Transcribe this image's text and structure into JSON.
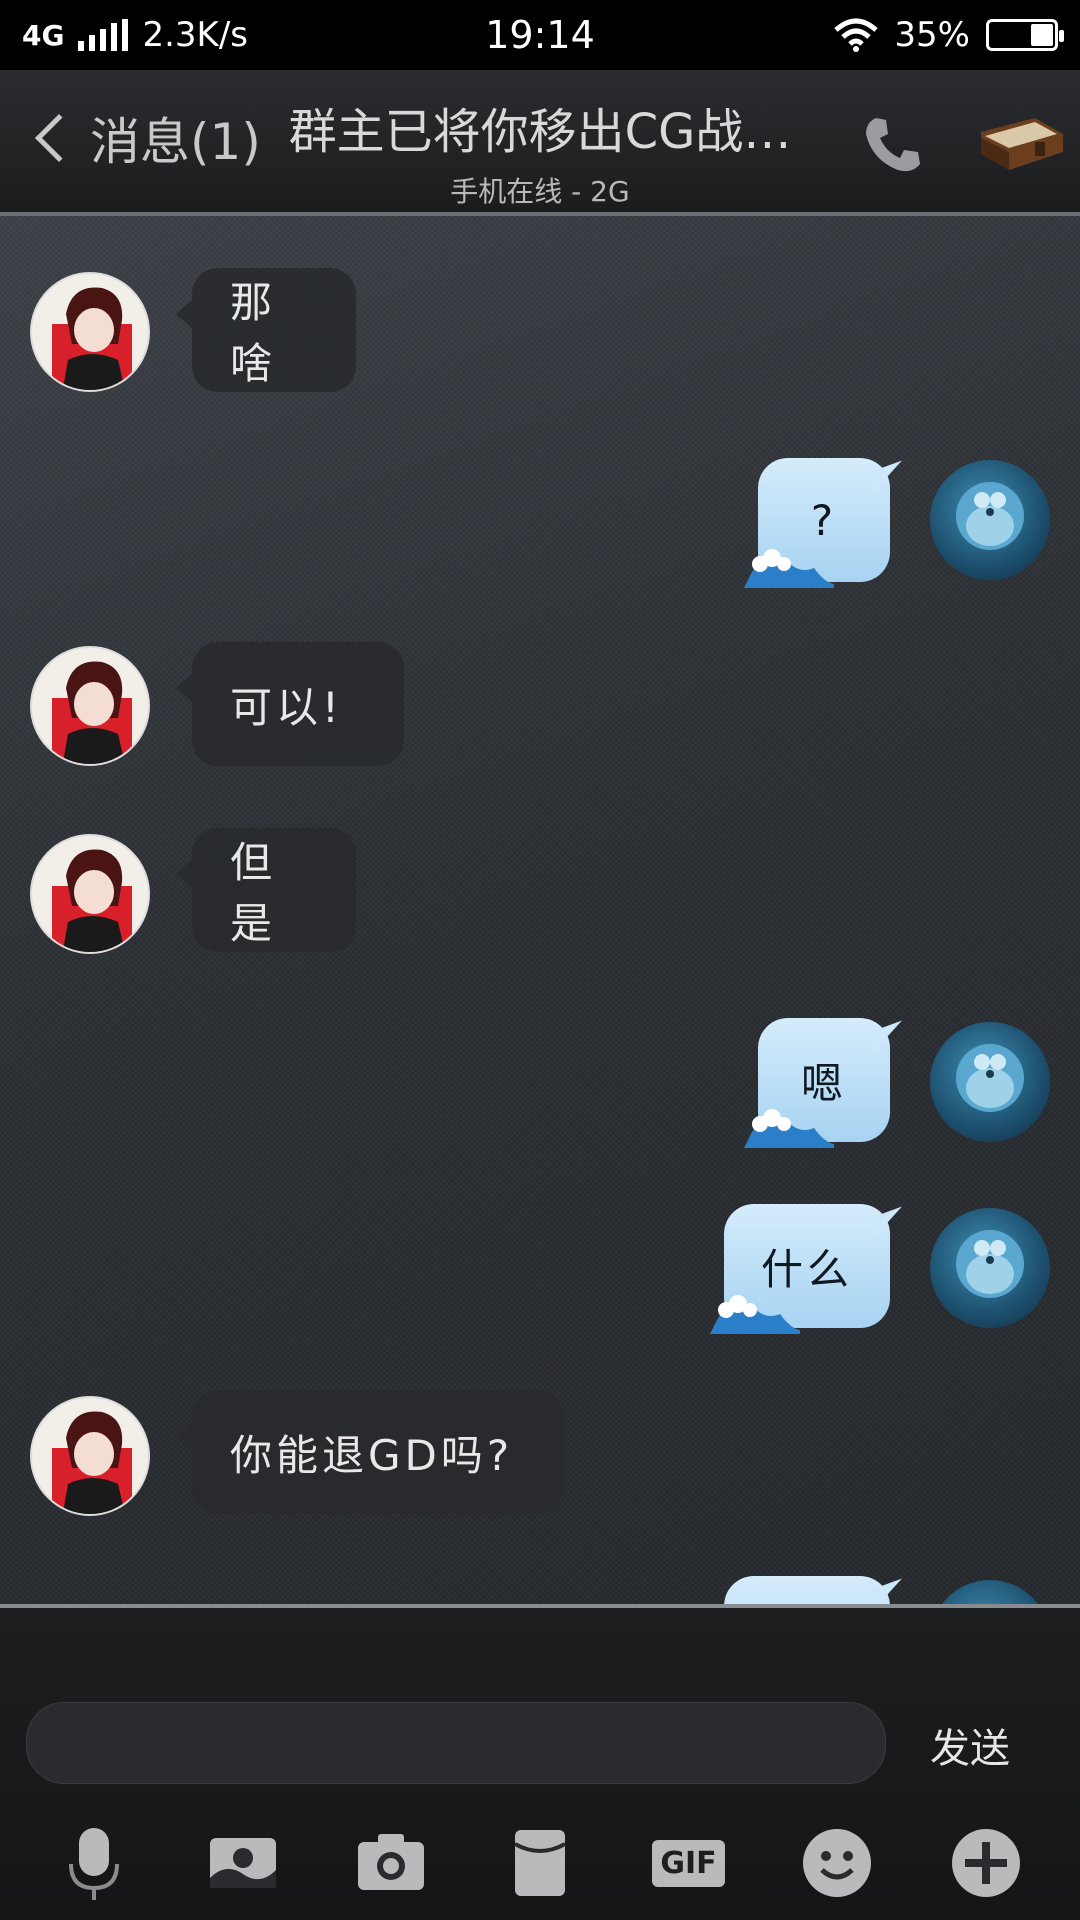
{
  "status_bar": {
    "network": "4G",
    "speed": "2.3K/s",
    "time": "19:14",
    "battery": "35%",
    "battery_level": 0.35,
    "icons": [
      "signal-icon",
      "wifi-icon",
      "battery-icon"
    ]
  },
  "header": {
    "back_label": "消息(1)",
    "title": "群主已将你移出CG战…",
    "subtitle": "手机在线 - 2G",
    "icons": [
      "back-chevron-icon",
      "phone-icon",
      "book-icon"
    ]
  },
  "messages": [
    {
      "side": "in",
      "text": "那啥"
    },
    {
      "side": "out",
      "text": "?"
    },
    {
      "side": "in",
      "text": "可以!"
    },
    {
      "side": "in",
      "text": "但是"
    },
    {
      "side": "out",
      "text": "嗯"
    },
    {
      "side": "out",
      "text": "什么"
    },
    {
      "side": "in",
      "text": "你能退GD吗?"
    }
  ],
  "composer": {
    "input_value": "",
    "send_label": "发送"
  },
  "toolbar": {
    "gif_label": "GIF",
    "icons": [
      "microphone-icon",
      "image-icon",
      "camera-icon",
      "red-packet-icon",
      "gif-icon",
      "emoji-icon",
      "plus-icon"
    ]
  },
  "colors": {
    "bubble_out": "#a7d3f2",
    "bubble_in": "#28292d",
    "background": "#2f3237"
  }
}
